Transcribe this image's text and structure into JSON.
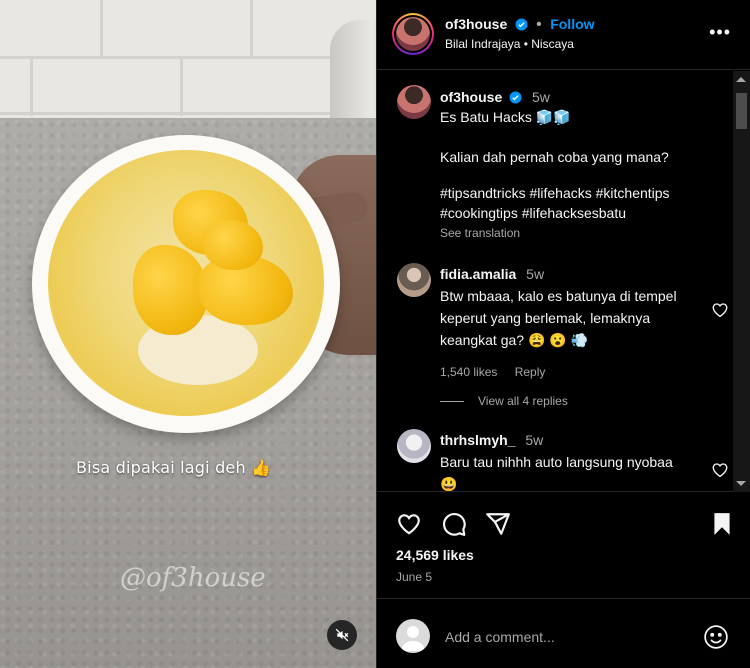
{
  "post": {
    "username": "of3house",
    "follow_label": "Follow",
    "audio": "Bilal Indrajaya • Niscaya",
    "more_label": "•••"
  },
  "media": {
    "overlay_text": "Bisa dipakai lagi deh 👍",
    "watermark": "@of3house",
    "mute_icon": "muted-speaker-icon"
  },
  "caption": {
    "username": "of3house",
    "time": "5w",
    "title": "Es Batu Hacks 🧊🧊",
    "body": "Kalian dah pernah coba yang mana?",
    "hashtags": "#tipsandtricks #lifehacks #kitchentips #cookingtips #lifehacksesbatu",
    "see_translation": "See translation"
  },
  "comments": [
    {
      "username": "fidia.amalia",
      "time": "5w",
      "text": "Btw mbaaa, kalo es batunya di tempel keperut yang berlemak, lemaknya keangkat ga? 😩 😮 💨",
      "likes": "1,540 likes",
      "reply": "Reply",
      "view_replies": "View all 4 replies"
    },
    {
      "username": "thrhslmyh_",
      "time": "5w",
      "text": "Baru tau nihhh auto langsung nyobaa😃"
    }
  ],
  "actions": {
    "like_icon": "heart-icon",
    "comment_icon": "comment-icon",
    "share_icon": "share-icon",
    "save_icon": "bookmark-icon"
  },
  "likes_count": "24,569 likes",
  "date": "June 5",
  "add_comment": {
    "placeholder": "Add a comment...",
    "emoji_icon": "emoji-icon"
  },
  "colors": {
    "accent": "#0095f6",
    "background": "#000000",
    "muted": "#a8a8a8",
    "divider": "#262626"
  }
}
